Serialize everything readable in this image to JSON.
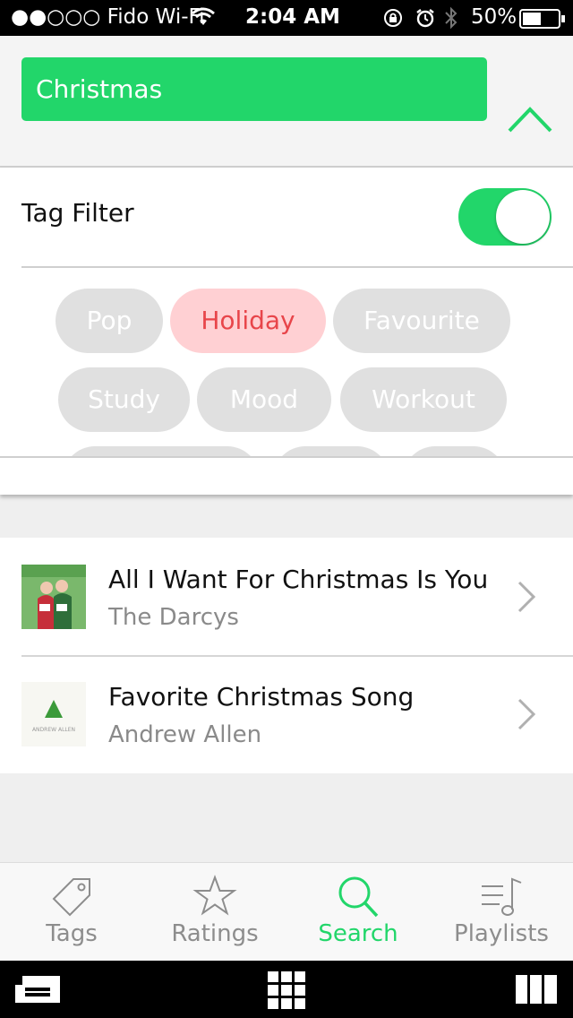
{
  "status_bar": {
    "carrier": "●●○○○ Fido Wi-Fi",
    "time": "2:04 AM",
    "battery": "50%"
  },
  "search": {
    "value": "Christmas"
  },
  "filter": {
    "label": "Tag Filter",
    "enabled": true,
    "tags": [
      {
        "label": "Pop",
        "selected": false
      },
      {
        "label": "Holiday",
        "selected": true
      },
      {
        "label": "Favourite",
        "selected": false
      },
      {
        "label": "Study",
        "selected": false
      },
      {
        "label": "Mood",
        "selected": false
      },
      {
        "label": "Workout",
        "selected": false
      }
    ]
  },
  "results": [
    {
      "title": "All I Want For Christmas Is You",
      "artist": "The Darcys"
    },
    {
      "title": "Favorite Christmas Song",
      "artist": "Andrew Allen",
      "art_text": "ANDREW ALLEN"
    }
  ],
  "tabs": [
    {
      "label": "Tags",
      "icon": "tag-icon",
      "active": false
    },
    {
      "label": "Ratings",
      "icon": "star-icon",
      "active": false
    },
    {
      "label": "Search",
      "icon": "search-icon",
      "active": true
    },
    {
      "label": "Playlists",
      "icon": "playlist-icon",
      "active": false
    }
  ],
  "colors": {
    "accent": "#22d66a",
    "selected_tag_bg": "#ffd0d3",
    "selected_tag_text": "#e8454a",
    "tag_bg": "#e0e0e0"
  }
}
